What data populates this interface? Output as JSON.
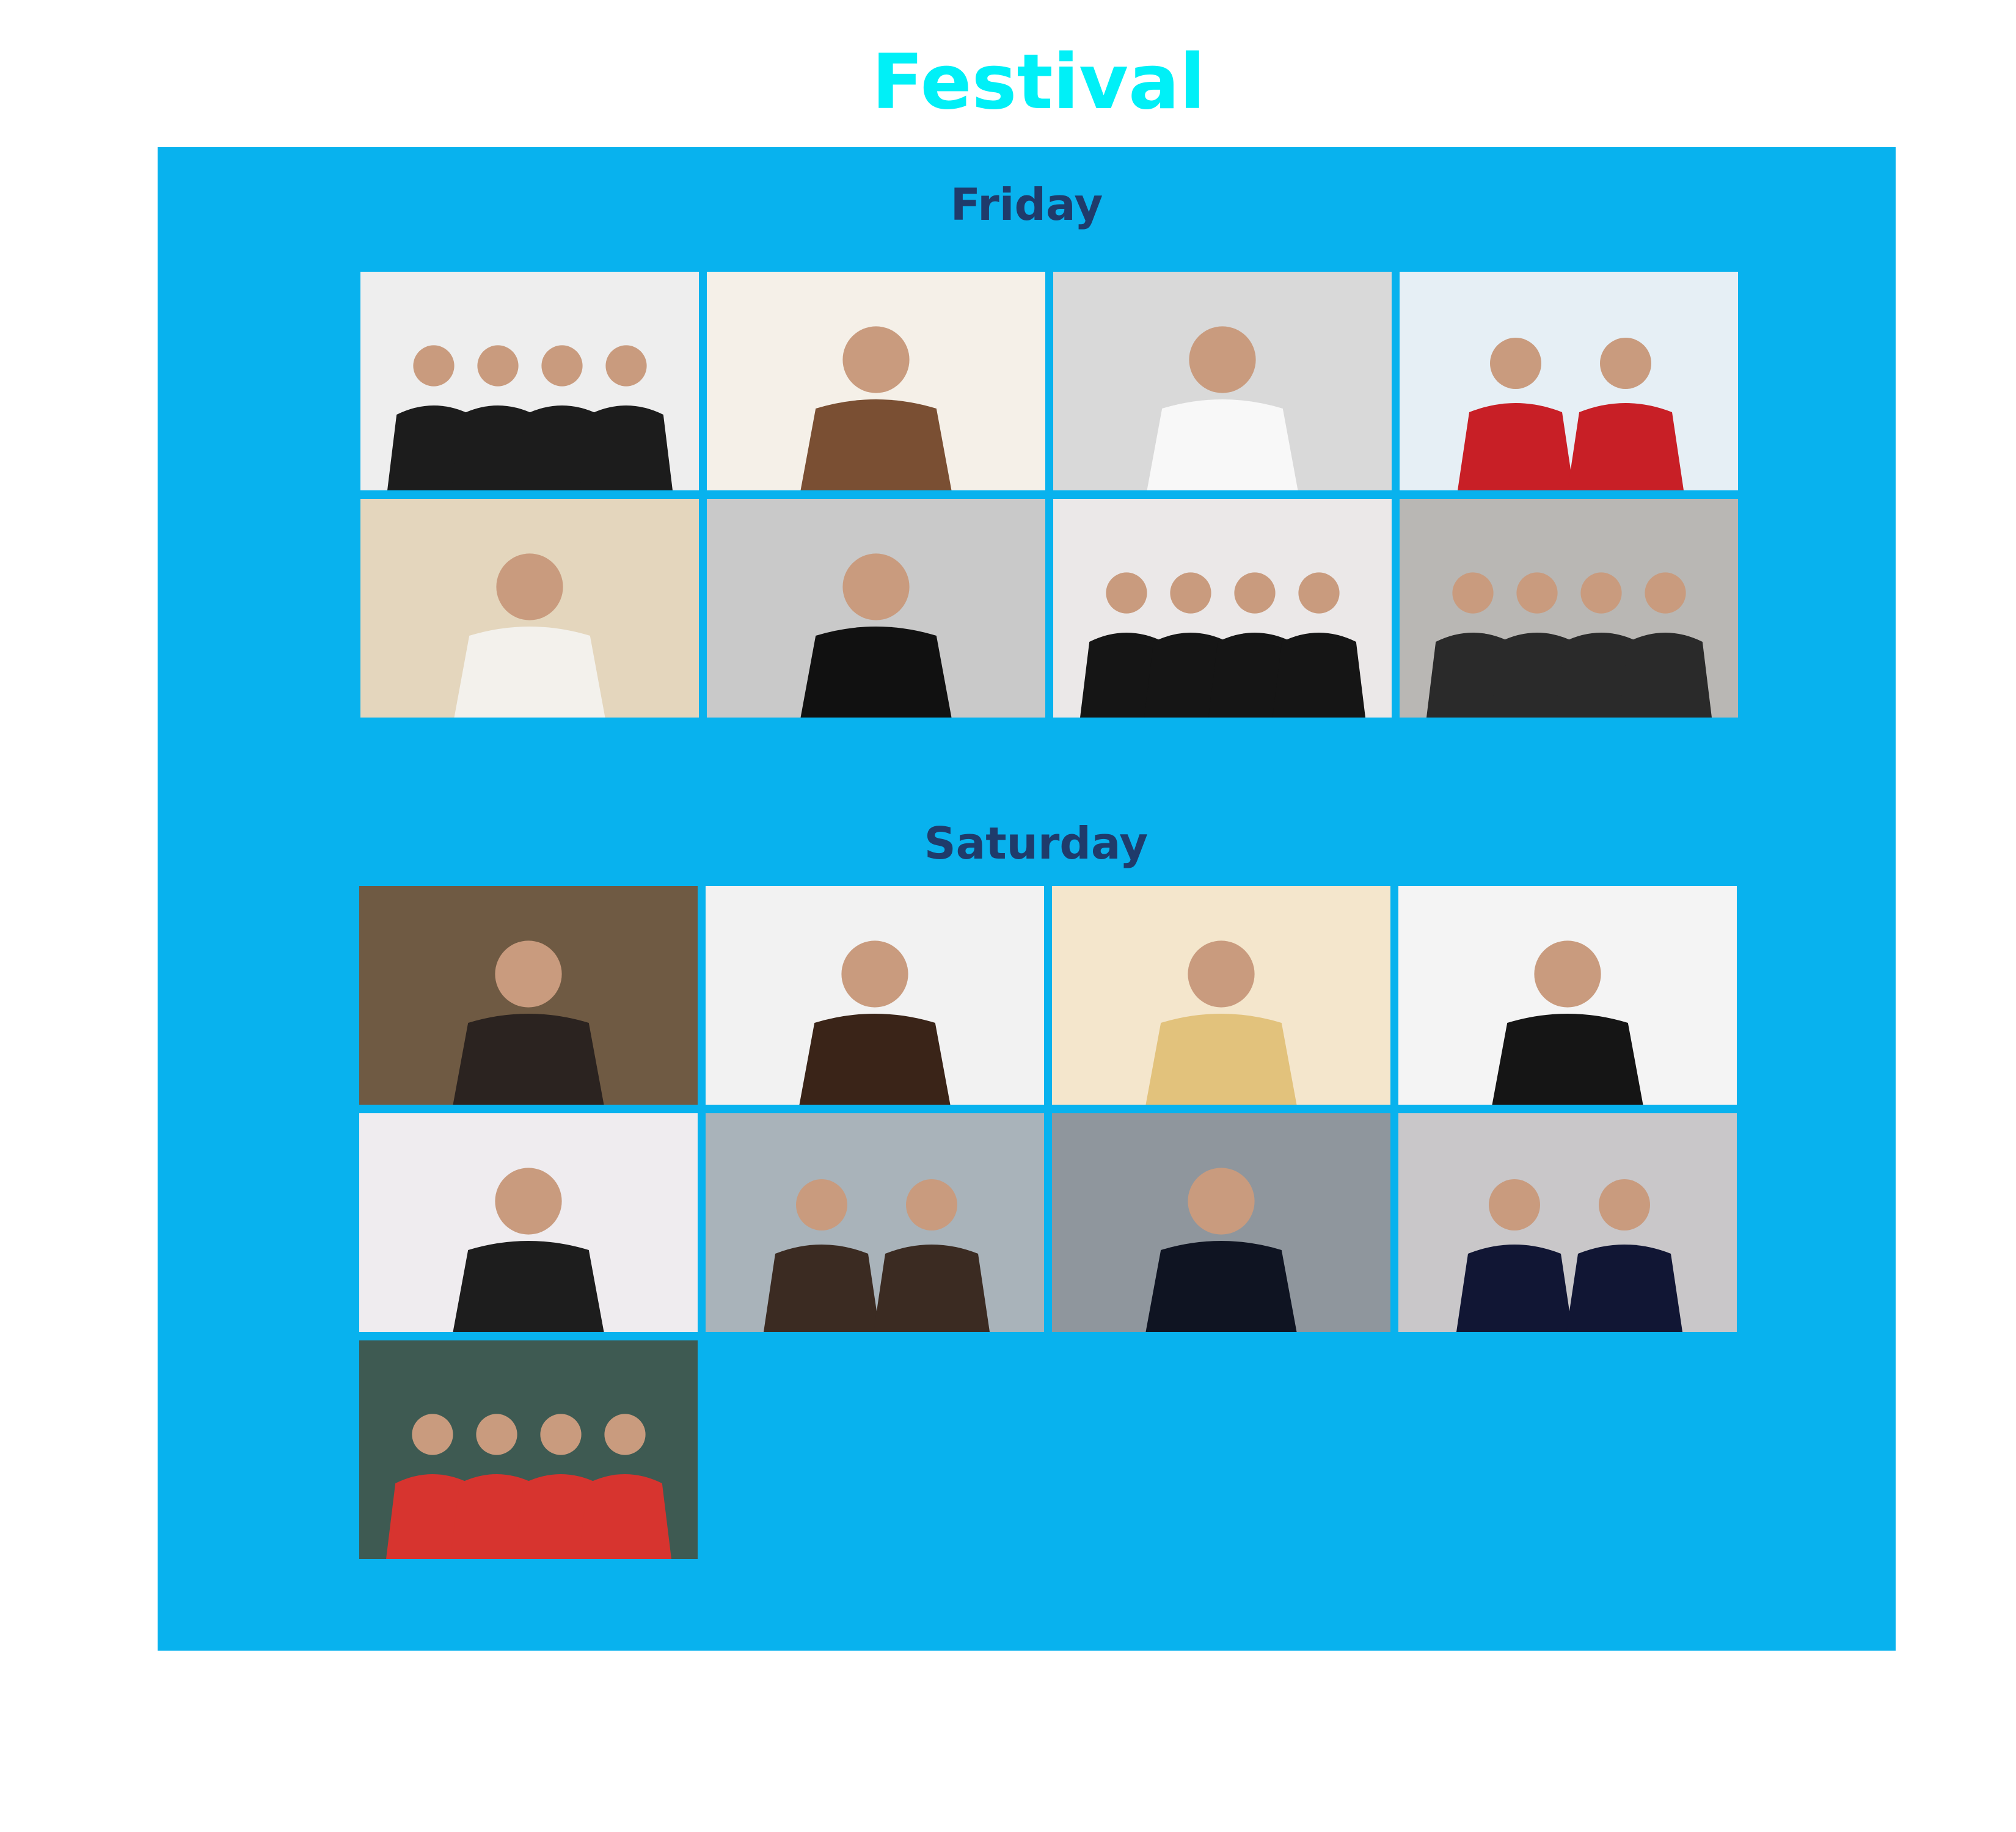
{
  "page": {
    "title": "Festival",
    "title_color": "#00f0f7",
    "panel_color": "#08b2ee",
    "heading_color": "#1f3b6b"
  },
  "days": [
    {
      "label": "Friday",
      "tiles": [
        {
          "icon": "band-photo-icon",
          "bg": "#eeeeee",
          "tone": "#1c1c1c"
        },
        {
          "icon": "artist-photo-icon",
          "bg": "#f5f0e8",
          "tone": "#7a4f33"
        },
        {
          "icon": "artist-photo-icon",
          "bg": "#d9d9d9",
          "tone": "#f8f8f8"
        },
        {
          "icon": "duo-photo-icon",
          "bg": "#e6eff5",
          "tone": "#c81f26"
        },
        {
          "icon": "artist-photo-icon",
          "bg": "#e4d6bd",
          "tone": "#f3f1ec"
        },
        {
          "icon": "artist-photo-icon",
          "bg": "#c9c9c9",
          "tone": "#111111"
        },
        {
          "icon": "band-photo-icon",
          "bg": "#ebe8e8",
          "tone": "#151515"
        },
        {
          "icon": "band-photo-icon",
          "bg": "#b9b7b4",
          "tone": "#2a2a2a"
        }
      ]
    },
    {
      "label": "Saturday",
      "tiles": [
        {
          "icon": "artist-photo-icon",
          "bg": "#6f5a43",
          "tone": "#2b2320"
        },
        {
          "icon": "artist-photo-icon",
          "bg": "#f2f2f2",
          "tone": "#3a2418"
        },
        {
          "icon": "artist-photo-icon",
          "bg": "#f4e6cc",
          "tone": "#e2c27c"
        },
        {
          "icon": "artist-photo-icon",
          "bg": "#f4f4f4",
          "tone": "#151515"
        },
        {
          "icon": "artist-photo-icon",
          "bg": "#efecef",
          "tone": "#1d1d1d"
        },
        {
          "icon": "duo-photo-icon",
          "bg": "#a9b3ba",
          "tone": "#3b2b22"
        },
        {
          "icon": "artist-photo-icon",
          "bg": "#8f969d",
          "tone": "#0f1422"
        },
        {
          "icon": "duo-photo-icon",
          "bg": "#c9c7c9",
          "tone": "#111634"
        },
        {
          "icon": "band-photo-icon",
          "bg": "#3e5a52",
          "tone": "#d7342f"
        }
      ]
    }
  ]
}
